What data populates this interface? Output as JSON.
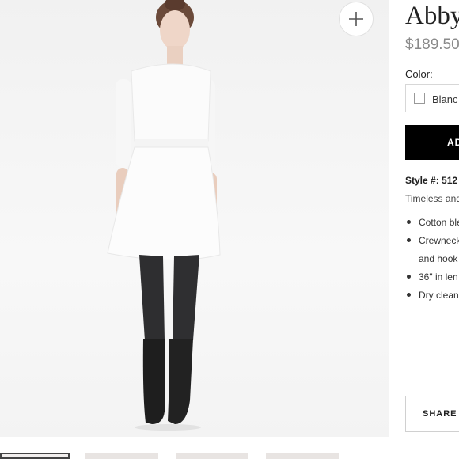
{
  "product": {
    "title": "Abby",
    "price": "$189.50",
    "color_label": "Color:",
    "color_value": "Blanc",
    "add_label": "AD",
    "style_label": "Style #:",
    "style_number": "512",
    "description": "Timeless and",
    "features": [
      "Cotton ble",
      "Crewneck",
      "and hook",
      "36\" in len",
      "Dry clean"
    ],
    "share_label": "SHARE"
  },
  "icons": {
    "zoom": "plus-icon"
  }
}
